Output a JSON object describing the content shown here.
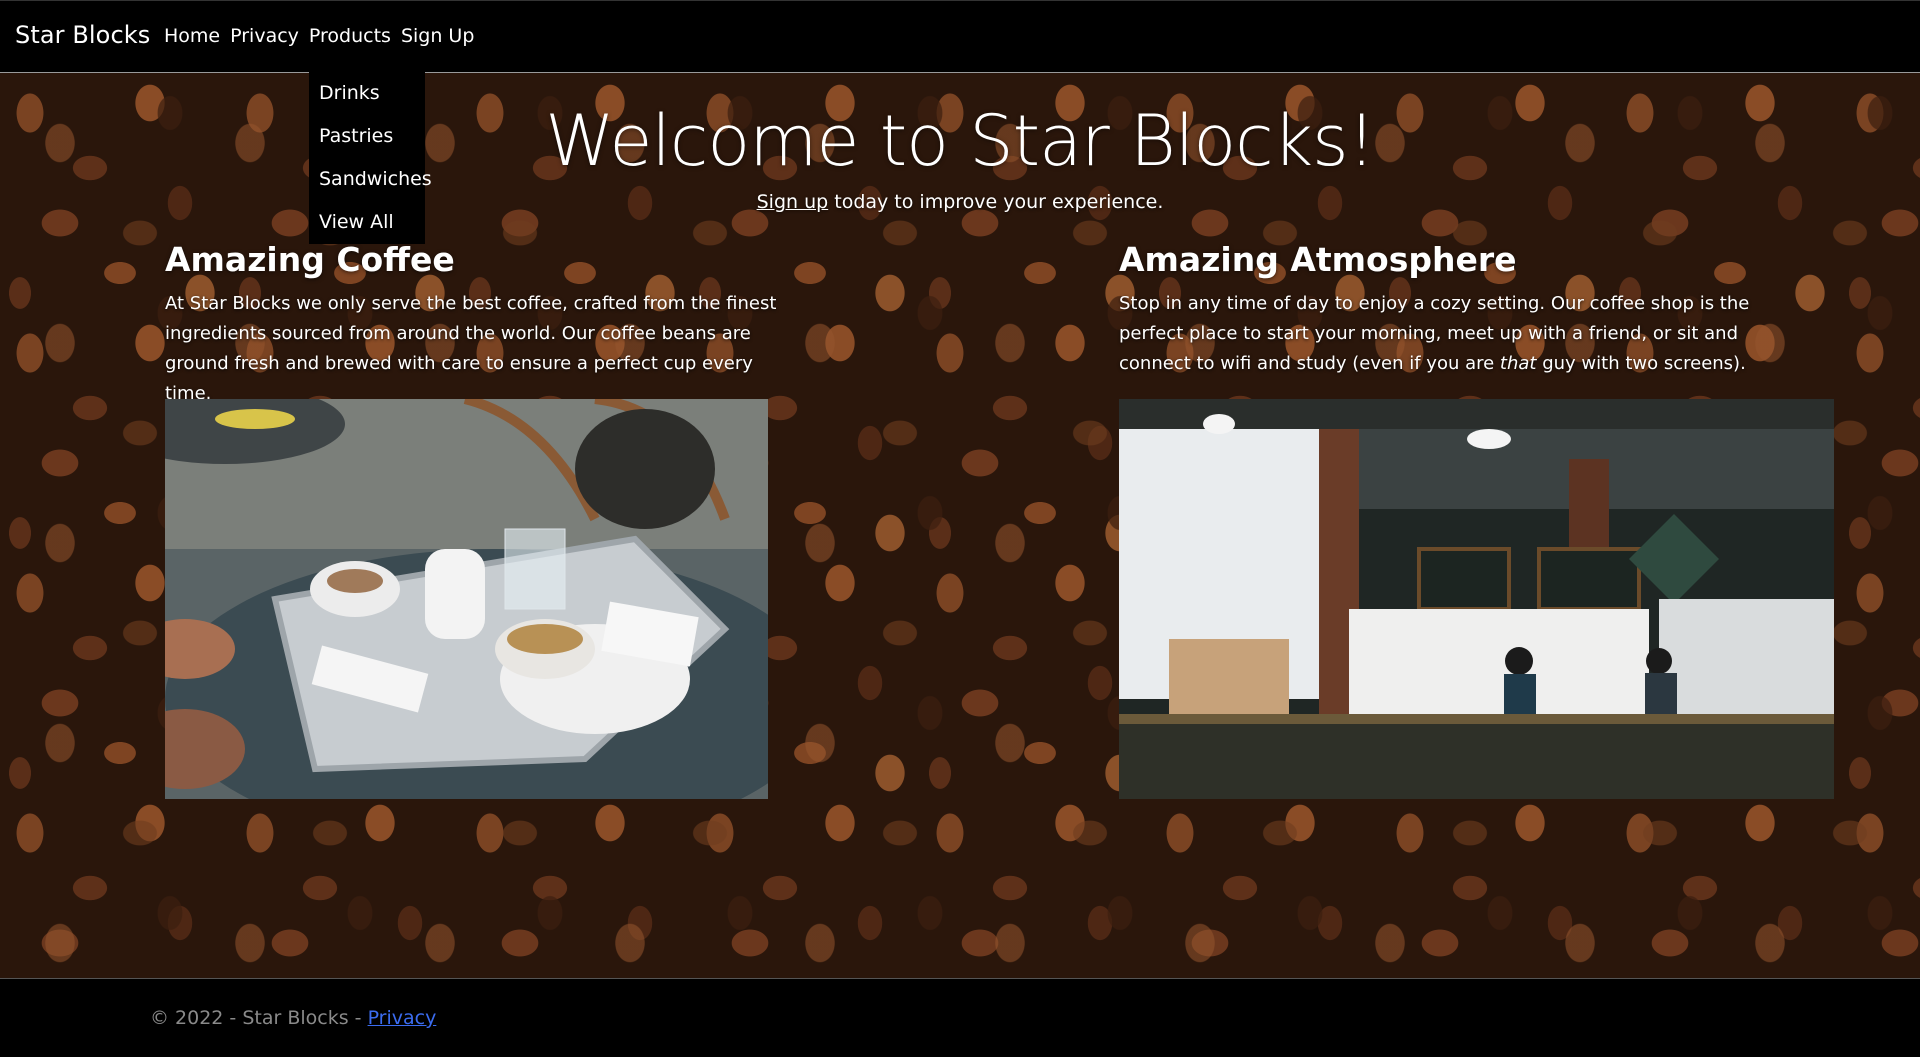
{
  "navbar": {
    "brand": "Star Blocks",
    "links": [
      "Home",
      "Privacy",
      "Products",
      "Sign Up"
    ],
    "dropdown": [
      "Drinks",
      "Pastries",
      "Sandwiches",
      "View All"
    ]
  },
  "hero": {
    "title": "Welcome to Star Blocks!",
    "signup_link": "Sign up",
    "subtitle_rest": " today to improve your experience."
  },
  "features": {
    "coffee": {
      "heading": "Amazing Coffee",
      "text": "At Star Blocks we only serve the best coffee, crafted from the finest ingredients sourced from around the world. Our coffee beans are ground fresh and brewed with care to ensure a perfect cup every time."
    },
    "atmosphere": {
      "heading": "Amazing Atmosphere",
      "text_before": "Stop in any time of day to enjoy a cozy setting. Our coffee shop is the perfect place to start your morning, meet up with a friend, or sit and connect to wifi and study (even if you are ",
      "text_italic": "that",
      "text_after": " guy with two screens)."
    }
  },
  "footer": {
    "copyright": "© 2022 - Star Blocks - ",
    "privacy_link": "Privacy"
  },
  "colors": {
    "background": "#000000",
    "link": "#3b6cf0",
    "footer_text": "#8a8a8a"
  }
}
